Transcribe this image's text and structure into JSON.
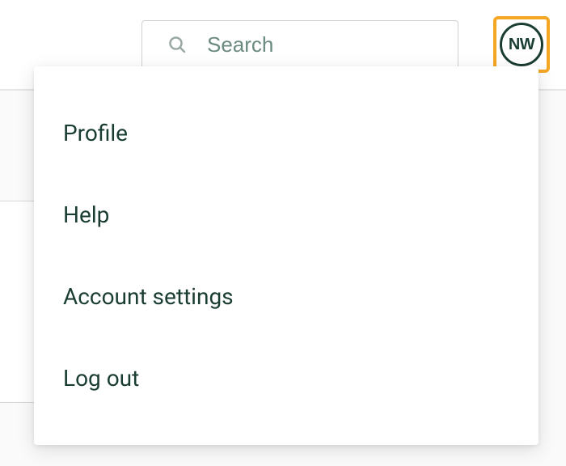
{
  "header": {
    "search": {
      "placeholder": "Search",
      "value": ""
    },
    "avatar": {
      "initials": "NW"
    }
  },
  "dropdown": {
    "items": [
      {
        "label": "Profile"
      },
      {
        "label": "Help"
      },
      {
        "label": "Account settings"
      },
      {
        "label": "Log out"
      }
    ]
  }
}
